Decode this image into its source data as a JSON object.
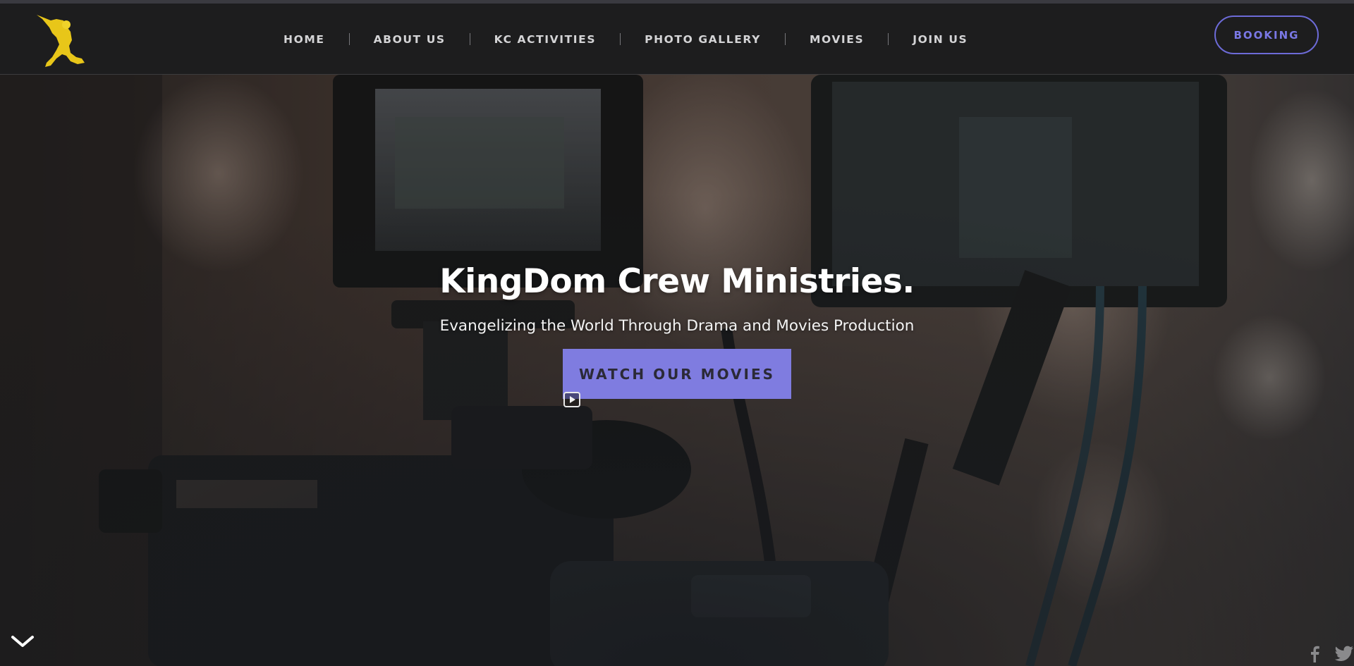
{
  "header": {
    "logo_icon": "dancer-silhouette-logo",
    "logo_color": "#e8c619",
    "nav": [
      {
        "label": "HOME"
      },
      {
        "label": "ABOUT US"
      },
      {
        "label": "KC ACTIVITIES"
      },
      {
        "label": "PHOTO GALLERY"
      },
      {
        "label": "MOVIES"
      },
      {
        "label": "JOIN US"
      }
    ],
    "booking_label": "BOOKING"
  },
  "hero": {
    "title": "KingDom Crew Ministries.",
    "subtitle": "Evangelizing the World Through Drama and Movies Production",
    "cta_label": "WATCH OUR MOVIES",
    "cta_color": "#7f7ce0",
    "background": "blurred film camera with monitors",
    "play_icon": "play-icon",
    "scroll_icon": "chevron-down-icon"
  },
  "social": {
    "icons": [
      "facebook-icon",
      "twitter-icon"
    ]
  }
}
